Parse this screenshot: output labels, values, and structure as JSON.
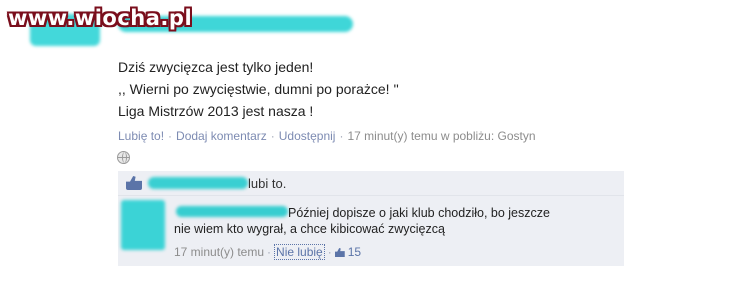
{
  "watermark": "www.wiocha.pl",
  "post": {
    "lines": [
      "Dziś zwycięzca jest tylko jeden!",
      ",, Wierni po zwycięstwie, dumni po porażce! ''",
      "Liga Mistrzów 2013 jest nasza !"
    ],
    "actions": {
      "like": "Lubię to!",
      "comment": "Dodaj komentarz",
      "share": "Udostępnij",
      "meta": "17 minut(y) temu w pobliżu: Gostyn"
    }
  },
  "likes": {
    "text": "lubi to."
  },
  "comment": {
    "line1": "Później dopisze o jaki klub chodziło, bo jeszcze",
    "line2": "nie wiem kto wygrał, a chce kibicować zwycięzcą",
    "time": "17 minut(y) temu",
    "unlike": "Nie lubię",
    "like_count": "15"
  },
  "colors": {
    "link": "#7d8bb2",
    "fb_blue": "#5b74a8",
    "panel_bg": "#edeff4",
    "censor": "#3fd6d8"
  }
}
